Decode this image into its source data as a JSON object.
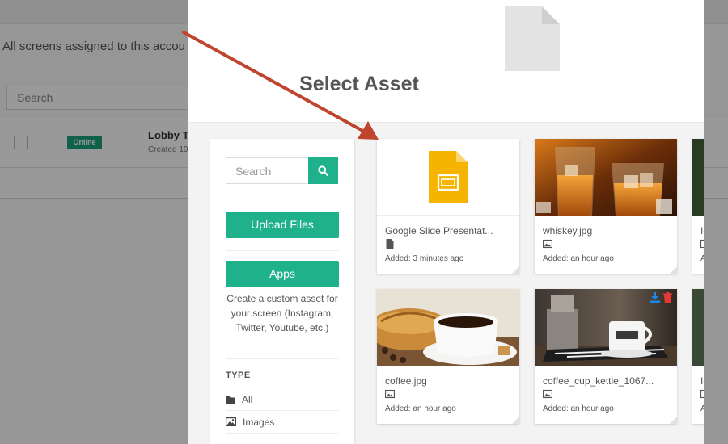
{
  "background": {
    "subtitle": "All screens assigned to this accou",
    "search_placeholder": "Search",
    "row": {
      "status": "Online",
      "name": "Lobby T",
      "created": "Created 10"
    }
  },
  "modal": {
    "title": "Select Asset",
    "sidebar": {
      "search_placeholder": "Search",
      "upload_label": "Upload Files",
      "apps_label": "Apps",
      "apps_description": "Create a custom asset for your screen (Instagram, Twitter, Youtube, etc.)",
      "type_heading": "TYPE",
      "types": [
        {
          "label": "All",
          "icon": "folder-icon"
        },
        {
          "label": "Images",
          "icon": "image-icon"
        }
      ]
    },
    "assets": [
      {
        "name": "Google Slide Presentat...",
        "type_icon": "file-icon",
        "added": "Added: 3 minutes ago",
        "thumb": "google-slides-icon"
      },
      {
        "name": "whiskey.jpg",
        "type_icon": "image-icon",
        "added": "Added: an hour ago",
        "thumb": "whiskey-photo"
      },
      {
        "name": "coffee.jpg",
        "type_icon": "image-icon",
        "added": "Added: an hour ago",
        "thumb": "coffee-photo"
      },
      {
        "name": "coffee_cup_kettle_1067...",
        "type_icon": "image-icon",
        "added": "Added: an hour ago",
        "thumb": "coffee-cup-kettle-photo"
      }
    ],
    "partial_cards": [
      {
        "name": "Ic",
        "added": "A"
      },
      {
        "name": "Ic",
        "added": "A"
      }
    ]
  },
  "colors": {
    "accent": "#1fb08c",
    "badge": "#1aa37a",
    "arrow": "#c0452f",
    "delete": "#e53935",
    "download": "#1e88e5"
  }
}
